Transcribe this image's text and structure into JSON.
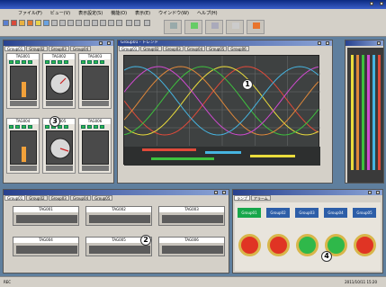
{
  "window": {
    "title": ""
  },
  "menu": [
    "ファイル(F)",
    "ビュー(V)",
    "表示設定(S)",
    "機能(O)",
    "表示(E)",
    "ウインドウ(W)",
    "ヘルプ(H)"
  ],
  "toolbar": {
    "big_buttons": [
      "",
      "",
      "",
      "",
      ""
    ]
  },
  "tag_window": {
    "tabs": [
      "Group01",
      "Group02",
      "Group03",
      "Group04"
    ],
    "tags": [
      {
        "name": "TAG001",
        "style": "bar",
        "level": 0.45
      },
      {
        "name": "TAG002",
        "style": "gauge",
        "level": 0.5
      },
      {
        "name": "TAG003",
        "style": "bar",
        "level": 0.0
      },
      {
        "name": "TAG004",
        "style": "bar",
        "level": 0.45
      },
      {
        "name": "TAG005",
        "style": "gauge",
        "level": 0.45
      },
      {
        "name": "TAG006",
        "style": "bar",
        "level": 0.0
      }
    ]
  },
  "trend_window": {
    "title": "Group01 - トレンド",
    "tabs": [
      "Group01",
      "Group02",
      "Group03",
      "Group04",
      "Group05",
      "Group06"
    ],
    "series_colors": [
      "#e04a3a",
      "#eadc3c",
      "#3ec13e",
      "#e0883a",
      "#d04ad0",
      "#46b4e0"
    ]
  },
  "panel_window": {
    "tabs": [
      "Group01",
      "Group02",
      "Group03",
      "Group04",
      "Group05"
    ],
    "panels": [
      "TAG001",
      "TAG002",
      "TAG003",
      "TAG004",
      "TAG005",
      "TAG006"
    ]
  },
  "lamp_window": {
    "tabs": [
      "ランプ",
      "アラーム"
    ],
    "headers": [
      "Group01",
      "Group02",
      "Group03",
      "Group04",
      "Group05"
    ],
    "lamps": [
      "red",
      "red",
      "green",
      "green",
      "red"
    ]
  },
  "annotations": [
    "1",
    "2",
    "3",
    "4"
  ],
  "status": {
    "left": "REC",
    "right": "2011/10/11  15:20"
  }
}
